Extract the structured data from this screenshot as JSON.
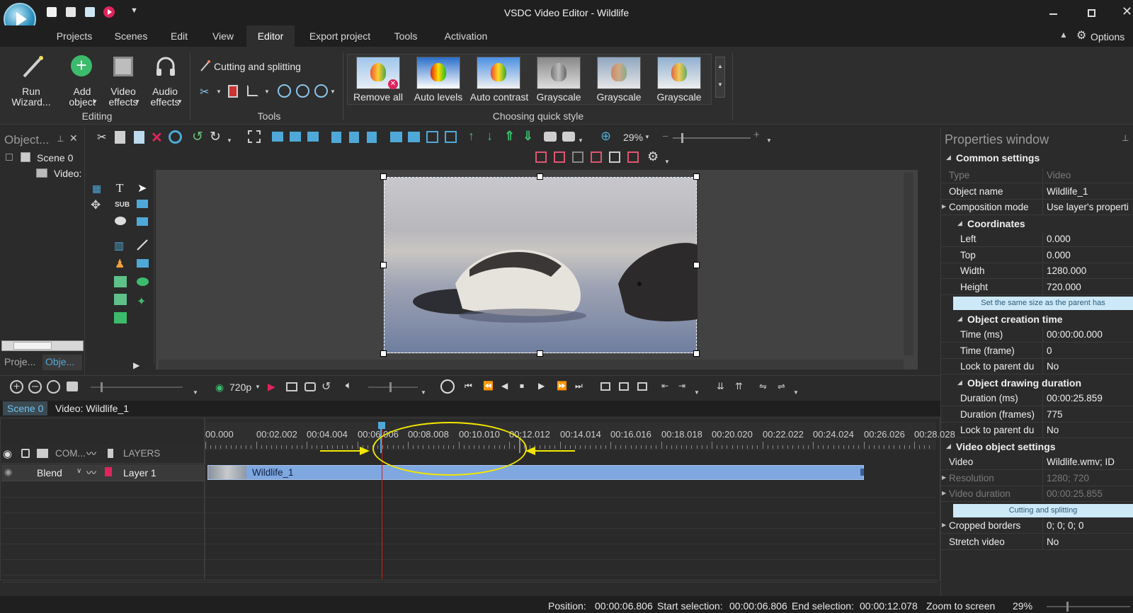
{
  "window": {
    "title": "VSDC Video Editor - Wildlife"
  },
  "menu": {
    "tabs": [
      "Projects",
      "Scenes",
      "Edit",
      "View",
      "Editor",
      "Export project",
      "Tools",
      "Activation"
    ],
    "options_label": "Options"
  },
  "ribbon": {
    "run_wizard": "Run Wizard...",
    "add_object": "Add object",
    "video_effects": "Video effects",
    "audio_effects": "Audio effects",
    "editing_group": "Editing",
    "cutting_splitting": "Cutting and splitting",
    "tools_group": "Tools",
    "quick_styles": [
      "Remove all",
      "Auto levels",
      "Auto contrast",
      "Grayscale",
      "Grayscale",
      "Grayscale"
    ],
    "quick_style_group": "Choosing quick style"
  },
  "object_panel": {
    "title": "Object...",
    "tree": [
      "Scene 0",
      "Video:"
    ],
    "bottom_tabs": [
      "Proje...",
      "Obje..."
    ]
  },
  "canvas_toolbar": {
    "zoom": "29%"
  },
  "properties": {
    "title": "Properties window",
    "common_settings": "Common settings",
    "rows_common": [
      {
        "label": "Type",
        "value": "Video"
      },
      {
        "label": "Object name",
        "value": "Wildlife_1"
      },
      {
        "label": "Composition mode",
        "value": "Use layer's properti"
      }
    ],
    "coordinates": "Coordinates",
    "rows_coords": [
      {
        "label": "Left",
        "value": "0.000"
      },
      {
        "label": "Top",
        "value": "0.000"
      },
      {
        "label": "Width",
        "value": "1280.000"
      },
      {
        "label": "Height",
        "value": "720.000"
      }
    ],
    "same_size_button": "Set the same size as the parent has",
    "creation_time": "Object creation time",
    "rows_creation": [
      {
        "label": "Time (ms)",
        "value": "00:00:00.000"
      },
      {
        "label": "Time (frame)",
        "value": "0"
      },
      {
        "label": "Lock to parent du",
        "value": "No"
      }
    ],
    "drawing_duration": "Object drawing duration",
    "rows_duration": [
      {
        "label": "Duration (ms)",
        "value": "00:00:25.859"
      },
      {
        "label": "Duration (frames)",
        "value": "775"
      },
      {
        "label": "Lock to parent du",
        "value": "No"
      }
    ],
    "video_settings": "Video object settings",
    "rows_video": [
      {
        "label": "Video",
        "value": "Wildlife.wmv; ID"
      },
      {
        "label": "Resolution",
        "value": "1280; 720"
      },
      {
        "label": "Video duration",
        "value": "00:00:25.855"
      }
    ],
    "cutting_button": "Cutting and splitting",
    "rows_video2": [
      {
        "label": "Cropped borders",
        "value": "0; 0; 0; 0"
      },
      {
        "label": "Stretch video",
        "value": "No"
      }
    ]
  },
  "timeline": {
    "quality": "720p",
    "tabs": [
      "Scene 0",
      "Video: Wildlife_1"
    ],
    "ruler": [
      "00.000",
      "00:02.002",
      "00:04.004",
      "00:06.006",
      "00:08.008",
      "00:10.010",
      "00:12.012",
      "00:14.014",
      "00:16.016",
      "00:18.018",
      "00:20.020",
      "00:22.022",
      "00:24.024",
      "00:26.026",
      "00:28.028"
    ],
    "header_row": {
      "com": "COM...",
      "layers": "LAYERS"
    },
    "layer_row": {
      "blend": "Blend",
      "layer": "Layer 1"
    },
    "clip_label": "Wildlife_1"
  },
  "status": {
    "position_label": "Position:",
    "position_value": "00:00:06.806",
    "start_label": "Start selection:",
    "start_value": "00:00:06.806",
    "end_label": "End selection:",
    "end_value": "00:00:12.078",
    "zoom_label": "Zoom to screen",
    "zoom_value": "29%"
  },
  "colors": {
    "accent_blue": "#7fa7e0",
    "highlight_cyan": "#4fa9d8",
    "annotation_yellow": "#f2e600",
    "playhead_red": "#d02020"
  }
}
